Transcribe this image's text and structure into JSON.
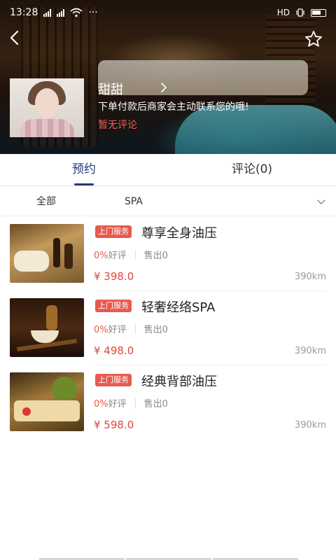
{
  "statusbar": {
    "time": "13:28",
    "network": "HD",
    "more": "···"
  },
  "profile": {
    "name": "甜甜",
    "description": "下单付款后商家会主动联系您的哦!",
    "rating_text": "暂无评论"
  },
  "tabs": [
    {
      "label": "预约",
      "active": true
    },
    {
      "label": "评论(0)",
      "active": false
    }
  ],
  "filter": {
    "all_label": "全部",
    "category_label": "SPA"
  },
  "services": [
    {
      "badge": "上门服务",
      "title": "尊享全身油压",
      "rating_pct": "0%",
      "rating_label": "好评",
      "sold_label": "售出0",
      "price": "¥ 398.0",
      "distance": "390km"
    },
    {
      "badge": "上门服务",
      "title": "轻奢经络SPA",
      "rating_pct": "0%",
      "rating_label": "好评",
      "sold_label": "售出0",
      "price": "¥ 498.0",
      "distance": "390km"
    },
    {
      "badge": "上门服务",
      "title": "经典背部油压",
      "rating_pct": "0%",
      "rating_label": "好评",
      "sold_label": "售出0",
      "price": "¥ 598.0",
      "distance": "390km"
    }
  ],
  "colors": {
    "accent_blue": "#1f3a7a",
    "badge_red": "#e85a4f",
    "price_red": "#e0463b",
    "rating_red": "#ff5a4d"
  },
  "icons": {
    "back": "chevron-left-icon",
    "favorite": "star-outline-icon",
    "profile_more": "chevron-right-icon",
    "filter_expand": "chevron-down-icon"
  }
}
